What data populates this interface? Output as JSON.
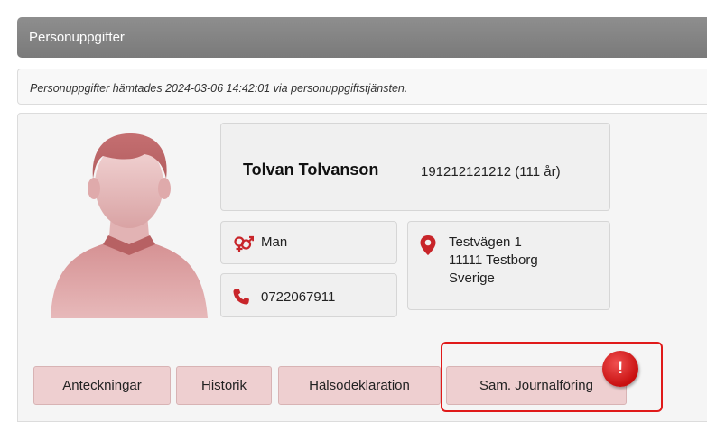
{
  "header": {
    "title": "Personuppgifter"
  },
  "info": {
    "message": "Personuppgifter hämtades 2024-03-06 14:42:01 via personuppgiftstjänsten."
  },
  "person": {
    "name": "Tolvan Tolvanson",
    "personnummer": "191212121212 (111 år)",
    "gender": "Man",
    "phone": "0722067911",
    "address": {
      "street": "Testvägen 1",
      "postal": "11111 Testborg",
      "country": "Sverige"
    }
  },
  "tabs": [
    {
      "label": "Anteckningar"
    },
    {
      "label": "Historik"
    },
    {
      "label": "Hälsodeklaration"
    },
    {
      "label": "Sam. Journalföring"
    }
  ],
  "alert": {
    "symbol": "!"
  },
  "icons": {
    "gender": "gender-icon",
    "phone": "phone-icon",
    "address": "location-pin-icon",
    "avatar": "person-avatar"
  },
  "colors": {
    "accent": "#c8252a",
    "tab_bg": "#eecfd0",
    "header_bg": "#858585",
    "highlight": "#e01a1a"
  }
}
